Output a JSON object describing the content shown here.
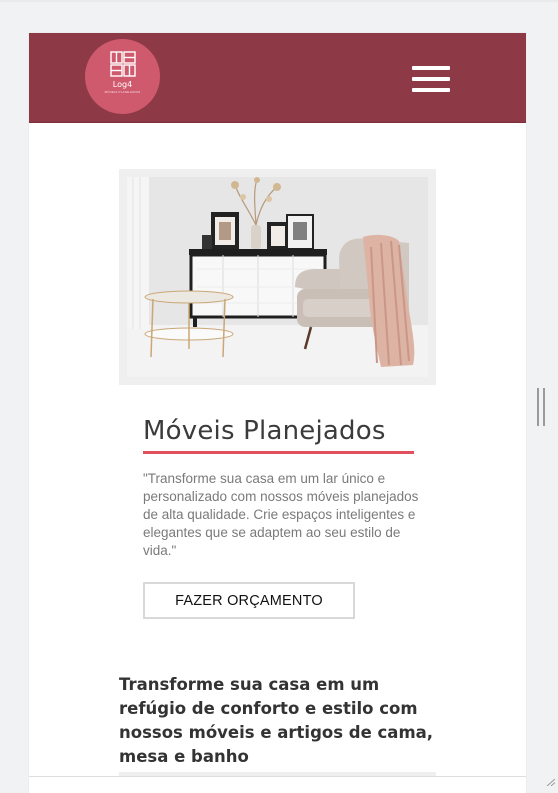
{
  "header": {
    "logo": {
      "name": "Log4",
      "tagline": "MÓVEIS PLANEJADOS",
      "icon": "window-logo-icon"
    },
    "menu_icon": "hamburger-menu-icon",
    "colors": {
      "bar": "#8e3a46",
      "logo_circle": "#cf5a6d"
    }
  },
  "hero": {
    "image_subject": "living-room-furniture-photo",
    "title": "Móveis Planejados",
    "description": "\"Transforme sua casa em um lar único e personalizado com nossos móveis planejados de alta qualidade. Crie espaços inteligentes e elegantes que se adaptem ao seu estilo de vida.\"",
    "cta_label": "FAZER ORÇAMENTO",
    "accent_color": "#e2505e"
  },
  "section": {
    "heading": "Transforme sua casa em um refúgio de conforto e estilo com nossos móveis e artigos de cama, mesa e banho"
  }
}
